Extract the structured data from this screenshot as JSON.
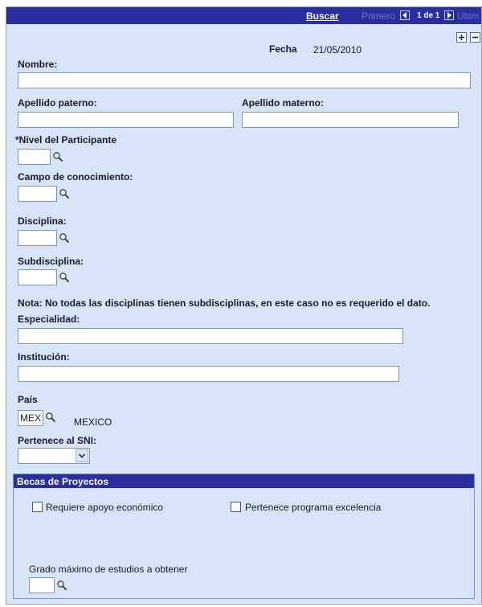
{
  "toolbar": {
    "buscar": "Buscar",
    "primero": "Primero",
    "count": "1 de 1",
    "ultimo": "Últim"
  },
  "header": {
    "fecha_label": "Fecha",
    "fecha_value": "21/05/2010"
  },
  "form": {
    "nombre_label": "Nombre:",
    "nombre_value": "",
    "apellido_paterno_label": "Apellido paterno:",
    "apellido_paterno_value": "",
    "apellido_materno_label": "Apellido materno:",
    "apellido_materno_value": "",
    "nivel_label": "*Nivel del Participante",
    "nivel_value": "",
    "campo_label": "Campo de conocimiento:",
    "campo_value": "",
    "disciplina_label": "Disciplina:",
    "disciplina_value": "",
    "subdisciplina_label": "Subdisciplina:",
    "subdisciplina_value": "",
    "nota": "Nota: No todas las disciplinas tienen subdisciplinas, en este caso no es requerido el dato.",
    "especialidad_label": "Especialidad:",
    "especialidad_value": "",
    "institucion_label": "Institución:",
    "institucion_value": "",
    "pais_label": "País",
    "pais_value": "MEX",
    "pais_desc": "MEXICO",
    "sni_label": "Pertenece al SNI:",
    "sni_value": ""
  },
  "becas": {
    "title": "Becas de Proyectos",
    "apoyo_label": "Requiere apoyo económico",
    "excelencia_label": "Pertenece programa excelencia",
    "grado_label": "Grado máximo de estudios a obtener",
    "grado_value": ""
  },
  "icons": [
    "first-icon",
    "last-icon",
    "plus-icon",
    "minus-icon",
    "magnifier-icon",
    "chevron-down-icon"
  ],
  "colors": {
    "header_bar": "#2a2ea0",
    "panel_bg": "#d8e4f8",
    "field_border": "#7f93b8"
  }
}
